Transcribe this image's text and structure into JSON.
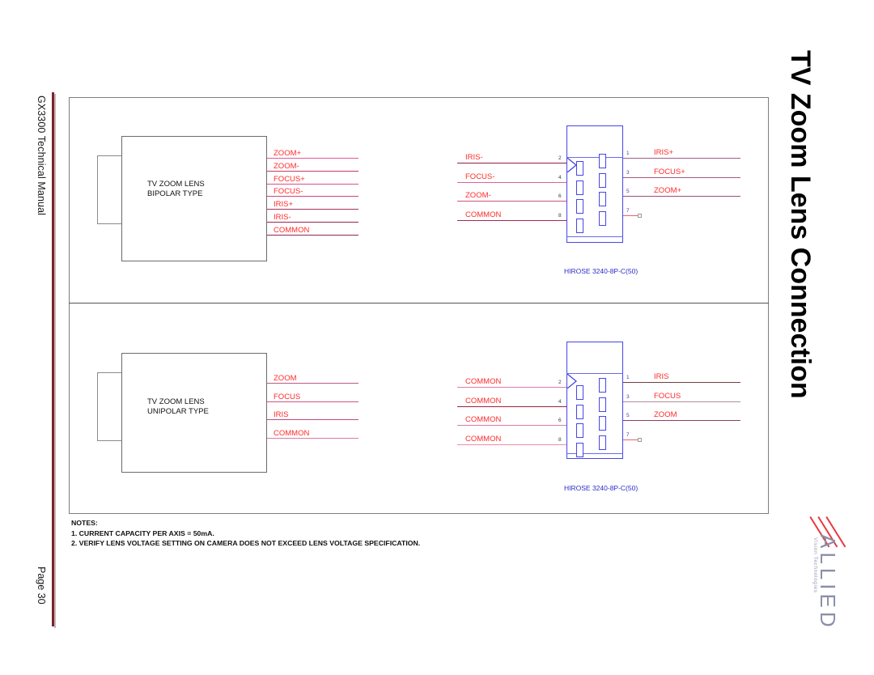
{
  "document": {
    "manual_title": "GX3300 Technical Manual",
    "page_label": "Page 30",
    "page_title": "TV Zoom Lens Connection"
  },
  "logo": {
    "word": "ALLIED",
    "tagline": "Vision Technologies",
    "accent_color": "#e8383f",
    "word_color": "#8b8fa8"
  },
  "colors": {
    "wire_label": "#ff2a2a",
    "connector": "#4646e8",
    "frame": "#7d7d7d",
    "sidebar_rule": "#7b2430"
  },
  "panels": [
    {
      "id": "bipolar",
      "lens": {
        "line1": "TV ZOOM LENS",
        "line2": "BIPOLAR TYPE"
      },
      "lens_wires": [
        {
          "label": "ZOOM+",
          "color": "#e4589a"
        },
        {
          "label": "ZOOM-",
          "color": "#c43a6e"
        },
        {
          "label": "FOCUS+",
          "color": "#d8508c"
        },
        {
          "label": "FOCUS-",
          "color": "#cf4480"
        },
        {
          "label": "IRIS+",
          "color": "#a8325e"
        },
        {
          "label": "IRIS-",
          "color": "#93284f"
        },
        {
          "label": "COMMON",
          "color": "#8d2a52"
        }
      ],
      "connector": {
        "caption": "HIROSE 3240-8P-C(50)",
        "left_pins": [
          {
            "pin": "2",
            "label": "IRIS-",
            "color": "#8f1f3f"
          },
          {
            "pin": "4",
            "label": "FOCUS-",
            "color": "#e1628f"
          },
          {
            "pin": "6",
            "label": "ZOOM-",
            "color": "#d4547f"
          },
          {
            "pin": "8",
            "label": "COMMON",
            "color": "#a32b4e"
          }
        ],
        "right_pins": [
          {
            "pin": "1",
            "label": "IRIS+",
            "color": "#9d5f86"
          },
          {
            "pin": "3",
            "label": "FOCUS+",
            "color": "#a05a80"
          },
          {
            "pin": "5",
            "label": "ZOOM+",
            "color": "#9a4f78"
          },
          {
            "pin": "7",
            "label": "",
            "color": "#e8636b"
          }
        ]
      }
    },
    {
      "id": "unipolar",
      "lens": {
        "line1": "TV ZOOM LENS",
        "line2": "UNIPOLAR TYPE"
      },
      "lens_wires": [
        {
          "label": "ZOOM",
          "color": "#b85a86"
        },
        {
          "label": "FOCUS",
          "color": "#d3548a"
        },
        {
          "label": "IRIS",
          "color": "#c24a7c"
        },
        {
          "label": "COMMON",
          "color": "#e07aa6"
        }
      ],
      "connector": {
        "caption": "HIROSE 3240-8P-C(50)",
        "left_pins": [
          {
            "pin": "2",
            "label": "COMMON",
            "color": "#e07aa6"
          },
          {
            "pin": "4",
            "label": "COMMON",
            "color": "#9b2340"
          },
          {
            "pin": "6",
            "label": "COMMON",
            "color": "#dd7aa3"
          },
          {
            "pin": "8",
            "label": "COMMON",
            "color": "#ef8ca8"
          }
        ],
        "right_pins": [
          {
            "pin": "1",
            "label": "IRIS",
            "color": "#6e4040"
          },
          {
            "pin": "3",
            "label": "FOCUS",
            "color": "#b08ea0"
          },
          {
            "pin": "5",
            "label": "ZOOM",
            "color": "#8f4060"
          },
          {
            "pin": "7",
            "label": "",
            "color": "#e8636b"
          }
        ]
      }
    }
  ],
  "notes": {
    "heading": "NOTES:",
    "items": [
      "1. CURRENT CAPACITY PER AXIS = 50mA.",
      "2. VERIFY LENS VOLTAGE SETTING ON CAMERA DOES NOT EXCEED LENS VOLTAGE SPECIFICATION."
    ]
  }
}
